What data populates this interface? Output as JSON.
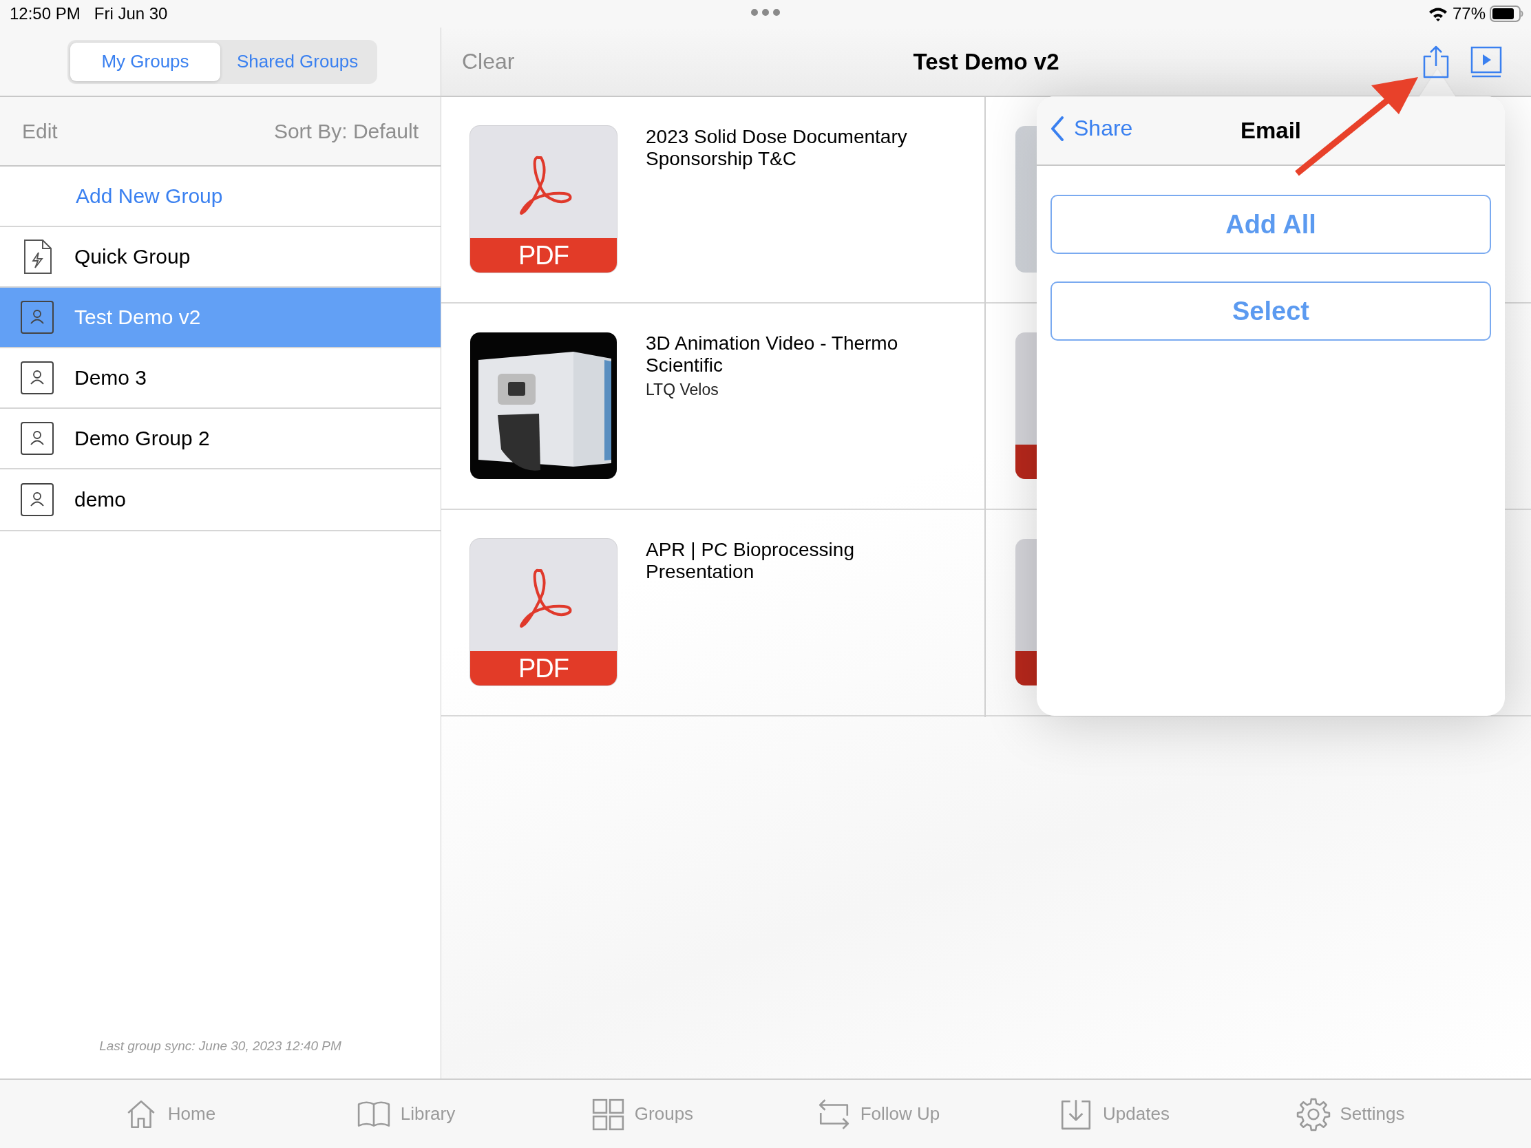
{
  "status_bar": {
    "time": "12:50 PM",
    "date": "Fri Jun 30",
    "battery": "77%"
  },
  "sidebar": {
    "segments": [
      {
        "label": "My Groups",
        "selected": true
      },
      {
        "label": "Shared Groups",
        "selected": false
      }
    ],
    "edit": "Edit",
    "sort": "Sort By: Default",
    "add_new_group": "Add New Group",
    "groups": [
      {
        "name": "Quick Group",
        "kind": "quick",
        "selected": false
      },
      {
        "name": "Test Demo v2",
        "kind": "person",
        "selected": true
      },
      {
        "name": "Demo 3",
        "kind": "person",
        "selected": false
      },
      {
        "name": "Demo Group 2",
        "kind": "person",
        "selected": false
      },
      {
        "name": "demo",
        "kind": "person",
        "selected": false
      }
    ],
    "sync_text": "Last group sync: June 30, 2023 12:40 PM"
  },
  "header": {
    "clear": "Clear",
    "title": "Test Demo v2"
  },
  "items": [
    {
      "kind": "pdf",
      "badge": "PDF",
      "title": "2023 Solid Dose Documentary Sponsorship T&C"
    },
    {
      "kind": "video",
      "title": "3D Animation Video - Thermo Scientific",
      "subtitle": "LTQ Velos"
    },
    {
      "kind": "pdf",
      "badge": "PDF",
      "title": "APR | PC Bioprocessing Presentation"
    }
  ],
  "peek_items": [
    {
      "kind": "photo"
    },
    {
      "kind": "pdf"
    },
    {
      "kind": "pdf"
    }
  ],
  "popover": {
    "back": "Share",
    "title": "Email",
    "buttons": [
      "Add All",
      "Select"
    ]
  },
  "tab_bar": [
    {
      "label": "Home",
      "kind": "home"
    },
    {
      "label": "Library",
      "kind": "book"
    },
    {
      "label": "Groups",
      "kind": "grid"
    },
    {
      "label": "Follow Up",
      "kind": "repeat"
    },
    {
      "label": "Updates",
      "kind": "download"
    },
    {
      "label": "Settings",
      "kind": "gear"
    }
  ]
}
